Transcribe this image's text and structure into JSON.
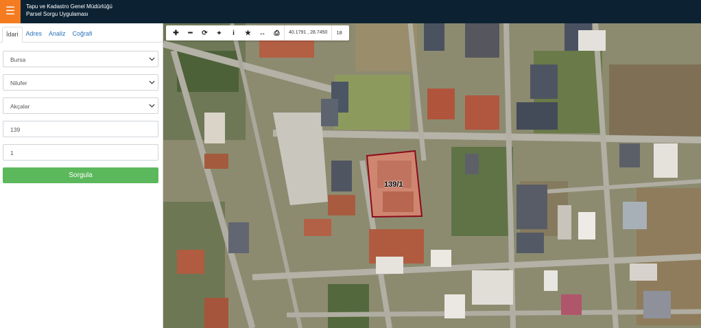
{
  "header": {
    "menu_icon": "hamburger-icon",
    "title_line1": "Tapu ve Kadastro Genel Müdürlüğü",
    "title_line2": "Parsel Sorgu Uygulaması",
    "accent_color": "#f47b20",
    "bar_color": "#0c2233"
  },
  "sidebar": {
    "tabs": [
      {
        "label": "İdari",
        "active": true
      },
      {
        "label": "Adres",
        "active": false
      },
      {
        "label": "Analiz",
        "active": false
      },
      {
        "label": "Coğrafi",
        "active": false
      }
    ],
    "il_select": "Bursa",
    "ilce_select": "Nilufer",
    "mahalle_select": "Akçalar",
    "ada_input": "139",
    "parsel_input": "1",
    "query_button": "Sorgula",
    "button_color": "#5cb85c"
  },
  "map": {
    "toolbar": {
      "tools": [
        "zoom-in-icon",
        "zoom-out-icon",
        "refresh-icon",
        "locate-icon",
        "info-icon",
        "star-icon",
        "measure-icon",
        "print-icon"
      ],
      "coordinates": "40.1791 , 28.7450",
      "zoom_level": "18"
    },
    "parcel_label": "139/1",
    "parcel_outline_color": "#8b0a1a"
  }
}
